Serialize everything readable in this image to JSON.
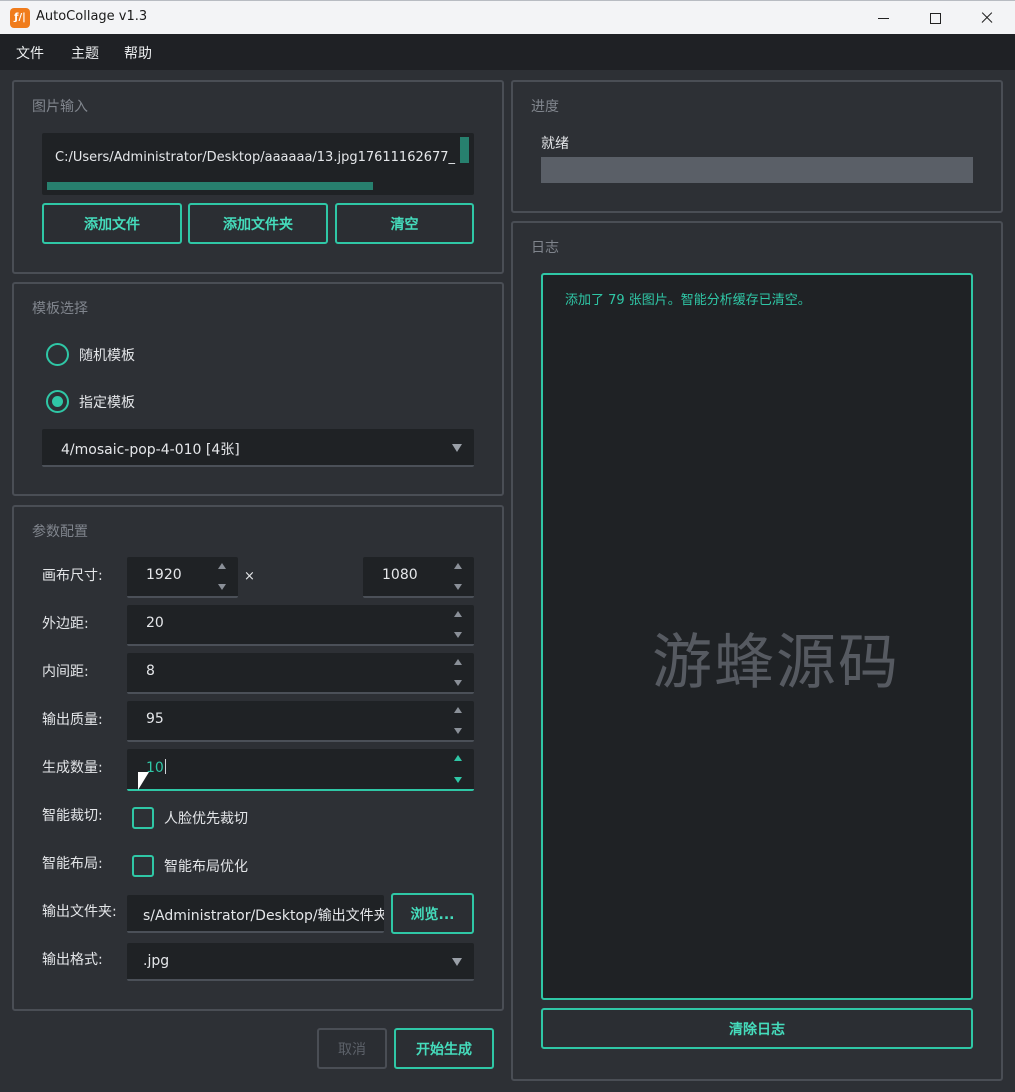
{
  "window": {
    "title": "AutoCollage v1.3",
    "app_icon_text": "ƒ/|"
  },
  "menu": [
    "文件",
    "主题",
    "帮助"
  ],
  "image_input": {
    "title": "图片输入",
    "path": "C:/Users/Administrator/Desktop/aaaaaa/13.jpg17611162677_",
    "buttons": {
      "add_files": "添加文件",
      "add_folder": "添加文件夹",
      "clear": "清空"
    }
  },
  "template": {
    "title": "模板选择",
    "random_label": "随机模板",
    "specified_label": "指定模板",
    "selected": "specified",
    "combo_value": "4/mosaic-pop-4-010 [4张]"
  },
  "params": {
    "title": "参数配置",
    "canvas_label": "画布尺寸:",
    "canvas_width": "1920",
    "times": "×",
    "canvas_height": "1080",
    "margin_label": "外边距:",
    "margin": "20",
    "spacing_label": "内间距:",
    "spacing": "8",
    "quality_label": "输出质量:",
    "quality": "95",
    "count_label": "生成数量:",
    "count": "10",
    "smart_crop_label": "智能裁切:",
    "face_crop": "人脸优先裁切",
    "smart_layout_label": "智能布局:",
    "layout_opt": "智能布局优化",
    "folder_label": "输出文件夹:",
    "folder": "s/Administrator/Desktop/输出文件夹",
    "browse": "浏览...",
    "format_label": "输出格式:",
    "format": ".jpg"
  },
  "actions": {
    "cancel": "取消",
    "start": "开始生成"
  },
  "progress": {
    "title": "进度",
    "status": "就绪",
    "value": 0
  },
  "log": {
    "title": "日志",
    "lines": [
      "添加了 79 张图片。智能分析缓存已清空。"
    ],
    "clear": "清除日志",
    "watermark": "游蜂源码"
  },
  "colors": {
    "accent": "#2fc7a6",
    "background": "#2d3035",
    "field": "#1f2225"
  }
}
